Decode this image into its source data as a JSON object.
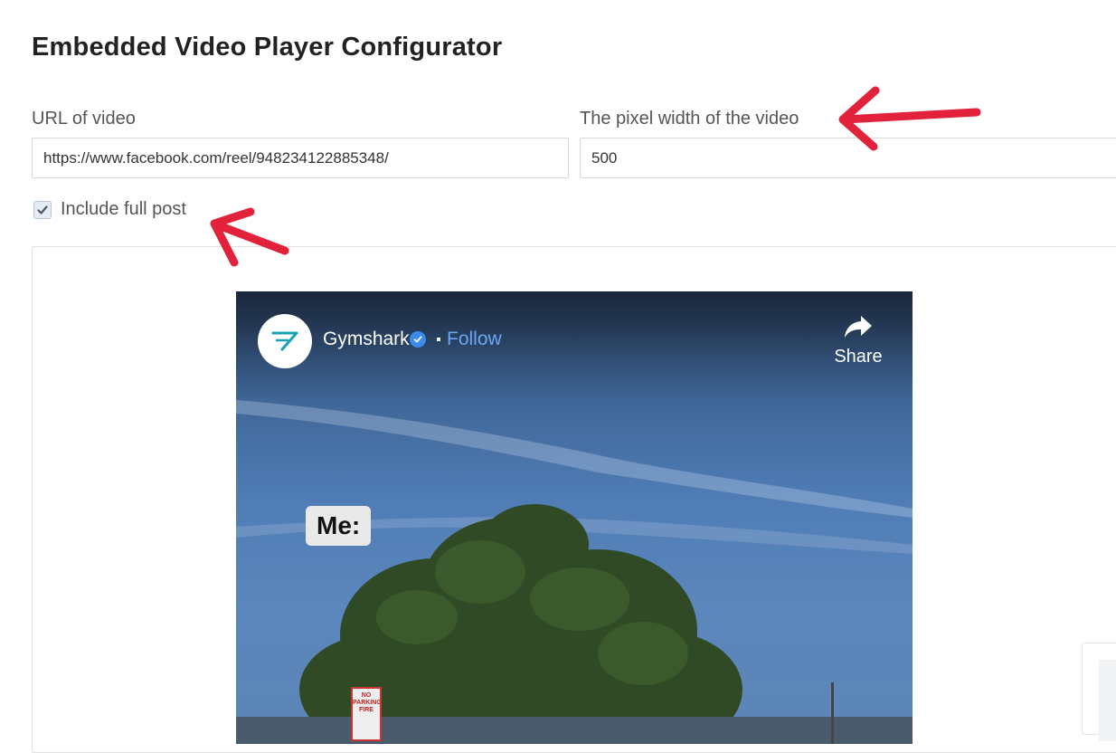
{
  "page": {
    "title": "Embedded Video Player Configurator"
  },
  "form": {
    "url_label": "URL of video",
    "url_value": "https://www.facebook.com/reel/948234122885348/",
    "width_label": "The pixel width of the video",
    "width_value": "500",
    "include_full_post_label": "Include full post",
    "include_full_post_checked": true
  },
  "video": {
    "channel_name": "Gymshark",
    "verified": true,
    "follow_label": "Follow",
    "share_label": "Share",
    "overlay_caption": "Me:",
    "sign_text": "NO PARKING FIRE"
  },
  "colors": {
    "annotation_arrow": "#e2213a",
    "follow_link": "#69a7f5",
    "verified_badge": "#3b8beb",
    "checkbox_bg": "#e3ecf7"
  }
}
